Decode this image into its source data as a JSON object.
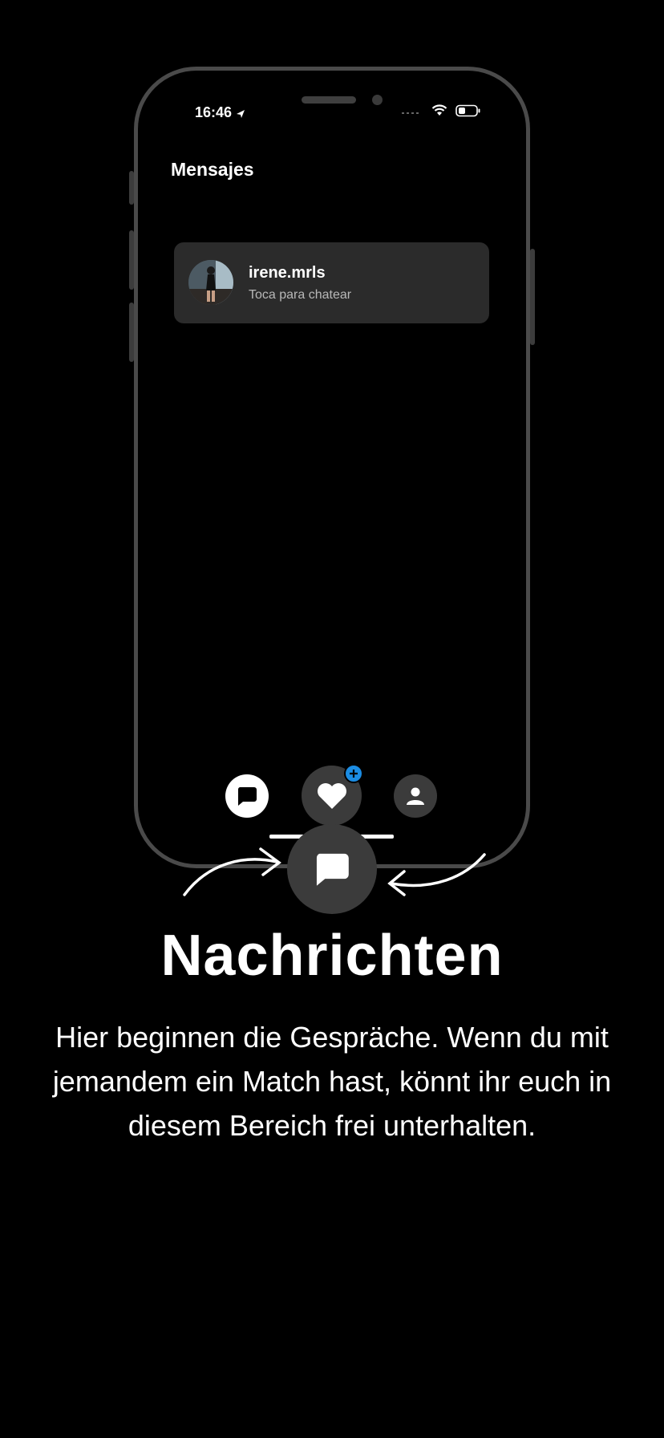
{
  "status_bar": {
    "time": "16:46"
  },
  "app": {
    "title": "Mensajes",
    "chat": {
      "name": "irene.mrls",
      "subtitle": "Toca para chatear"
    }
  },
  "tabbar": {
    "items": [
      {
        "icon": "chat-bubble-icon",
        "active": true
      },
      {
        "icon": "heart-icon",
        "badge": "+"
      },
      {
        "icon": "person-icon"
      }
    ]
  },
  "feature": {
    "heading": "Nachrichten",
    "description": "Hier beginnen die Gespräche. Wenn du mit jemandem ein Match hast, könnt ihr euch in diesem Bereich frei unterhalten."
  },
  "colors": {
    "background": "#000000",
    "card": "#2b2b2b",
    "badge": "#1b8ce3",
    "frame": "#4a4a4a"
  }
}
